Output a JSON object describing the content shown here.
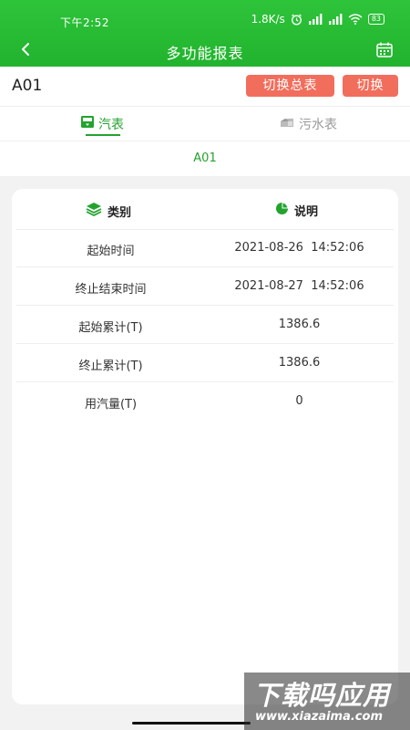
{
  "status_bar": {
    "time": "下午2:52",
    "network_speed": "1.8K/s",
    "battery": "83",
    "icons": [
      "alarm-icon",
      "signal-icon",
      "signal-icon",
      "wifi-icon",
      "battery-icon"
    ]
  },
  "nav": {
    "title": "多功能报表",
    "back_icon": "chevron-left-icon",
    "calendar_icon": "calendar-icon"
  },
  "station": {
    "name": "A01",
    "switch_total_label": "切换总表",
    "switch_label": "切换"
  },
  "tabs": [
    {
      "label": "汽表",
      "icon": "meter-icon",
      "active": true
    },
    {
      "label": "污水表",
      "icon": "meter-icon",
      "active": false
    }
  ],
  "subtitle": "A01",
  "table": {
    "headers": {
      "category": "类别",
      "description": "说明"
    },
    "rows": [
      {
        "label": "起始时间",
        "value": "2021-08-26  14:52:06"
      },
      {
        "label": "终止结束时间",
        "value": "2021-08-27  14:52:06"
      },
      {
        "label": "起始累计(T)",
        "value": "1386.6"
      },
      {
        "label": "终止累计(T)",
        "value": "1386.6"
      },
      {
        "label": "用汽量(T)",
        "value": "0"
      }
    ]
  },
  "watermark": {
    "title": "下载吗应用",
    "url": "www.xiazaima.com"
  },
  "colors": {
    "primary_green": "#22b32e",
    "button_red": "#f26e5c",
    "tab_active": "#22a32d"
  }
}
